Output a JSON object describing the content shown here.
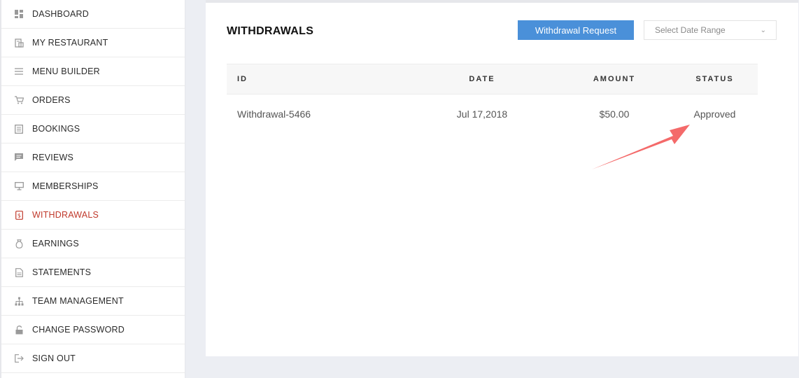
{
  "sidebar": {
    "items": [
      {
        "label": "DASHBOARD",
        "icon": "dashboard-icon"
      },
      {
        "label": "MY RESTAURANT",
        "icon": "restaurant-icon"
      },
      {
        "label": "MENU BUILDER",
        "icon": "menu-icon"
      },
      {
        "label": "ORDERS",
        "icon": "cart-icon"
      },
      {
        "label": "BOOKINGS",
        "icon": "bookings-icon"
      },
      {
        "label": "REVIEWS",
        "icon": "reviews-icon"
      },
      {
        "label": "MEMBERSHIPS",
        "icon": "membership-icon"
      },
      {
        "label": "WITHDRAWALS",
        "icon": "withdrawals-icon",
        "active": true
      },
      {
        "label": "EARNINGS",
        "icon": "earnings-icon"
      },
      {
        "label": "STATEMENTS",
        "icon": "statements-icon"
      },
      {
        "label": "TEAM MANAGEMENT",
        "icon": "team-icon"
      },
      {
        "label": "CHANGE PASSWORD",
        "icon": "lock-icon"
      },
      {
        "label": "SIGN OUT",
        "icon": "sign-out-icon"
      }
    ],
    "active_color": "#c0392b"
  },
  "main": {
    "title": "WITHDRAWALS",
    "request_button": "Withdrawal Request",
    "date_range_placeholder": "Select Date Range",
    "accent_color": "#4a90d9",
    "table": {
      "headers": {
        "id": "ID",
        "date": "DATE",
        "amount": "AMOUNT",
        "status": "STATUS"
      },
      "rows": [
        {
          "id": "Withdrawal-5466",
          "date": "Jul 17,2018",
          "amount": "$50.00",
          "status": "Approved"
        }
      ]
    }
  },
  "annotation": {
    "arrow_color": "#f46a6a"
  }
}
